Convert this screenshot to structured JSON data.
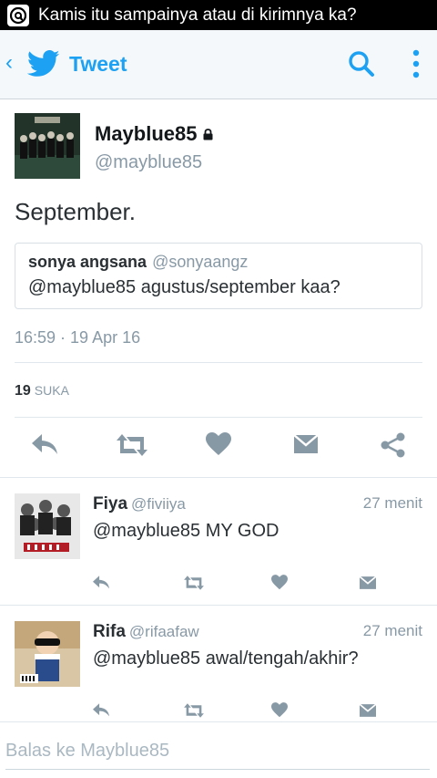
{
  "notification": {
    "text": "Kamis itu sampainya atau di kirimnya ka?"
  },
  "appbar": {
    "title": "Tweet"
  },
  "tweet": {
    "author_name": "Mayblue85",
    "author_handle": "@mayblue85",
    "text": "September.",
    "quote": {
      "name": "sonya angsana",
      "handle": "@sonyaangz",
      "text": "@mayblue85 agustus/september kaa?"
    },
    "timestamp": "16:59 · 19 Apr 16",
    "likes_count": "19",
    "likes_label": "SUKA"
  },
  "replies": [
    {
      "name": "Fiya",
      "handle": "@fiviiya",
      "time": "27 menit",
      "text": "@mayblue85 MY GOD"
    },
    {
      "name": "Rifa",
      "handle": "@rifaafaw",
      "time": "27 menit",
      "text": "@mayblue85 awal/tengah/akhir?"
    }
  ],
  "composer": {
    "placeholder": "Balas ke Mayblue85"
  },
  "colors": {
    "accent": "#1da1f2",
    "icon_gray": "#8899a6",
    "text": "#292f33"
  }
}
